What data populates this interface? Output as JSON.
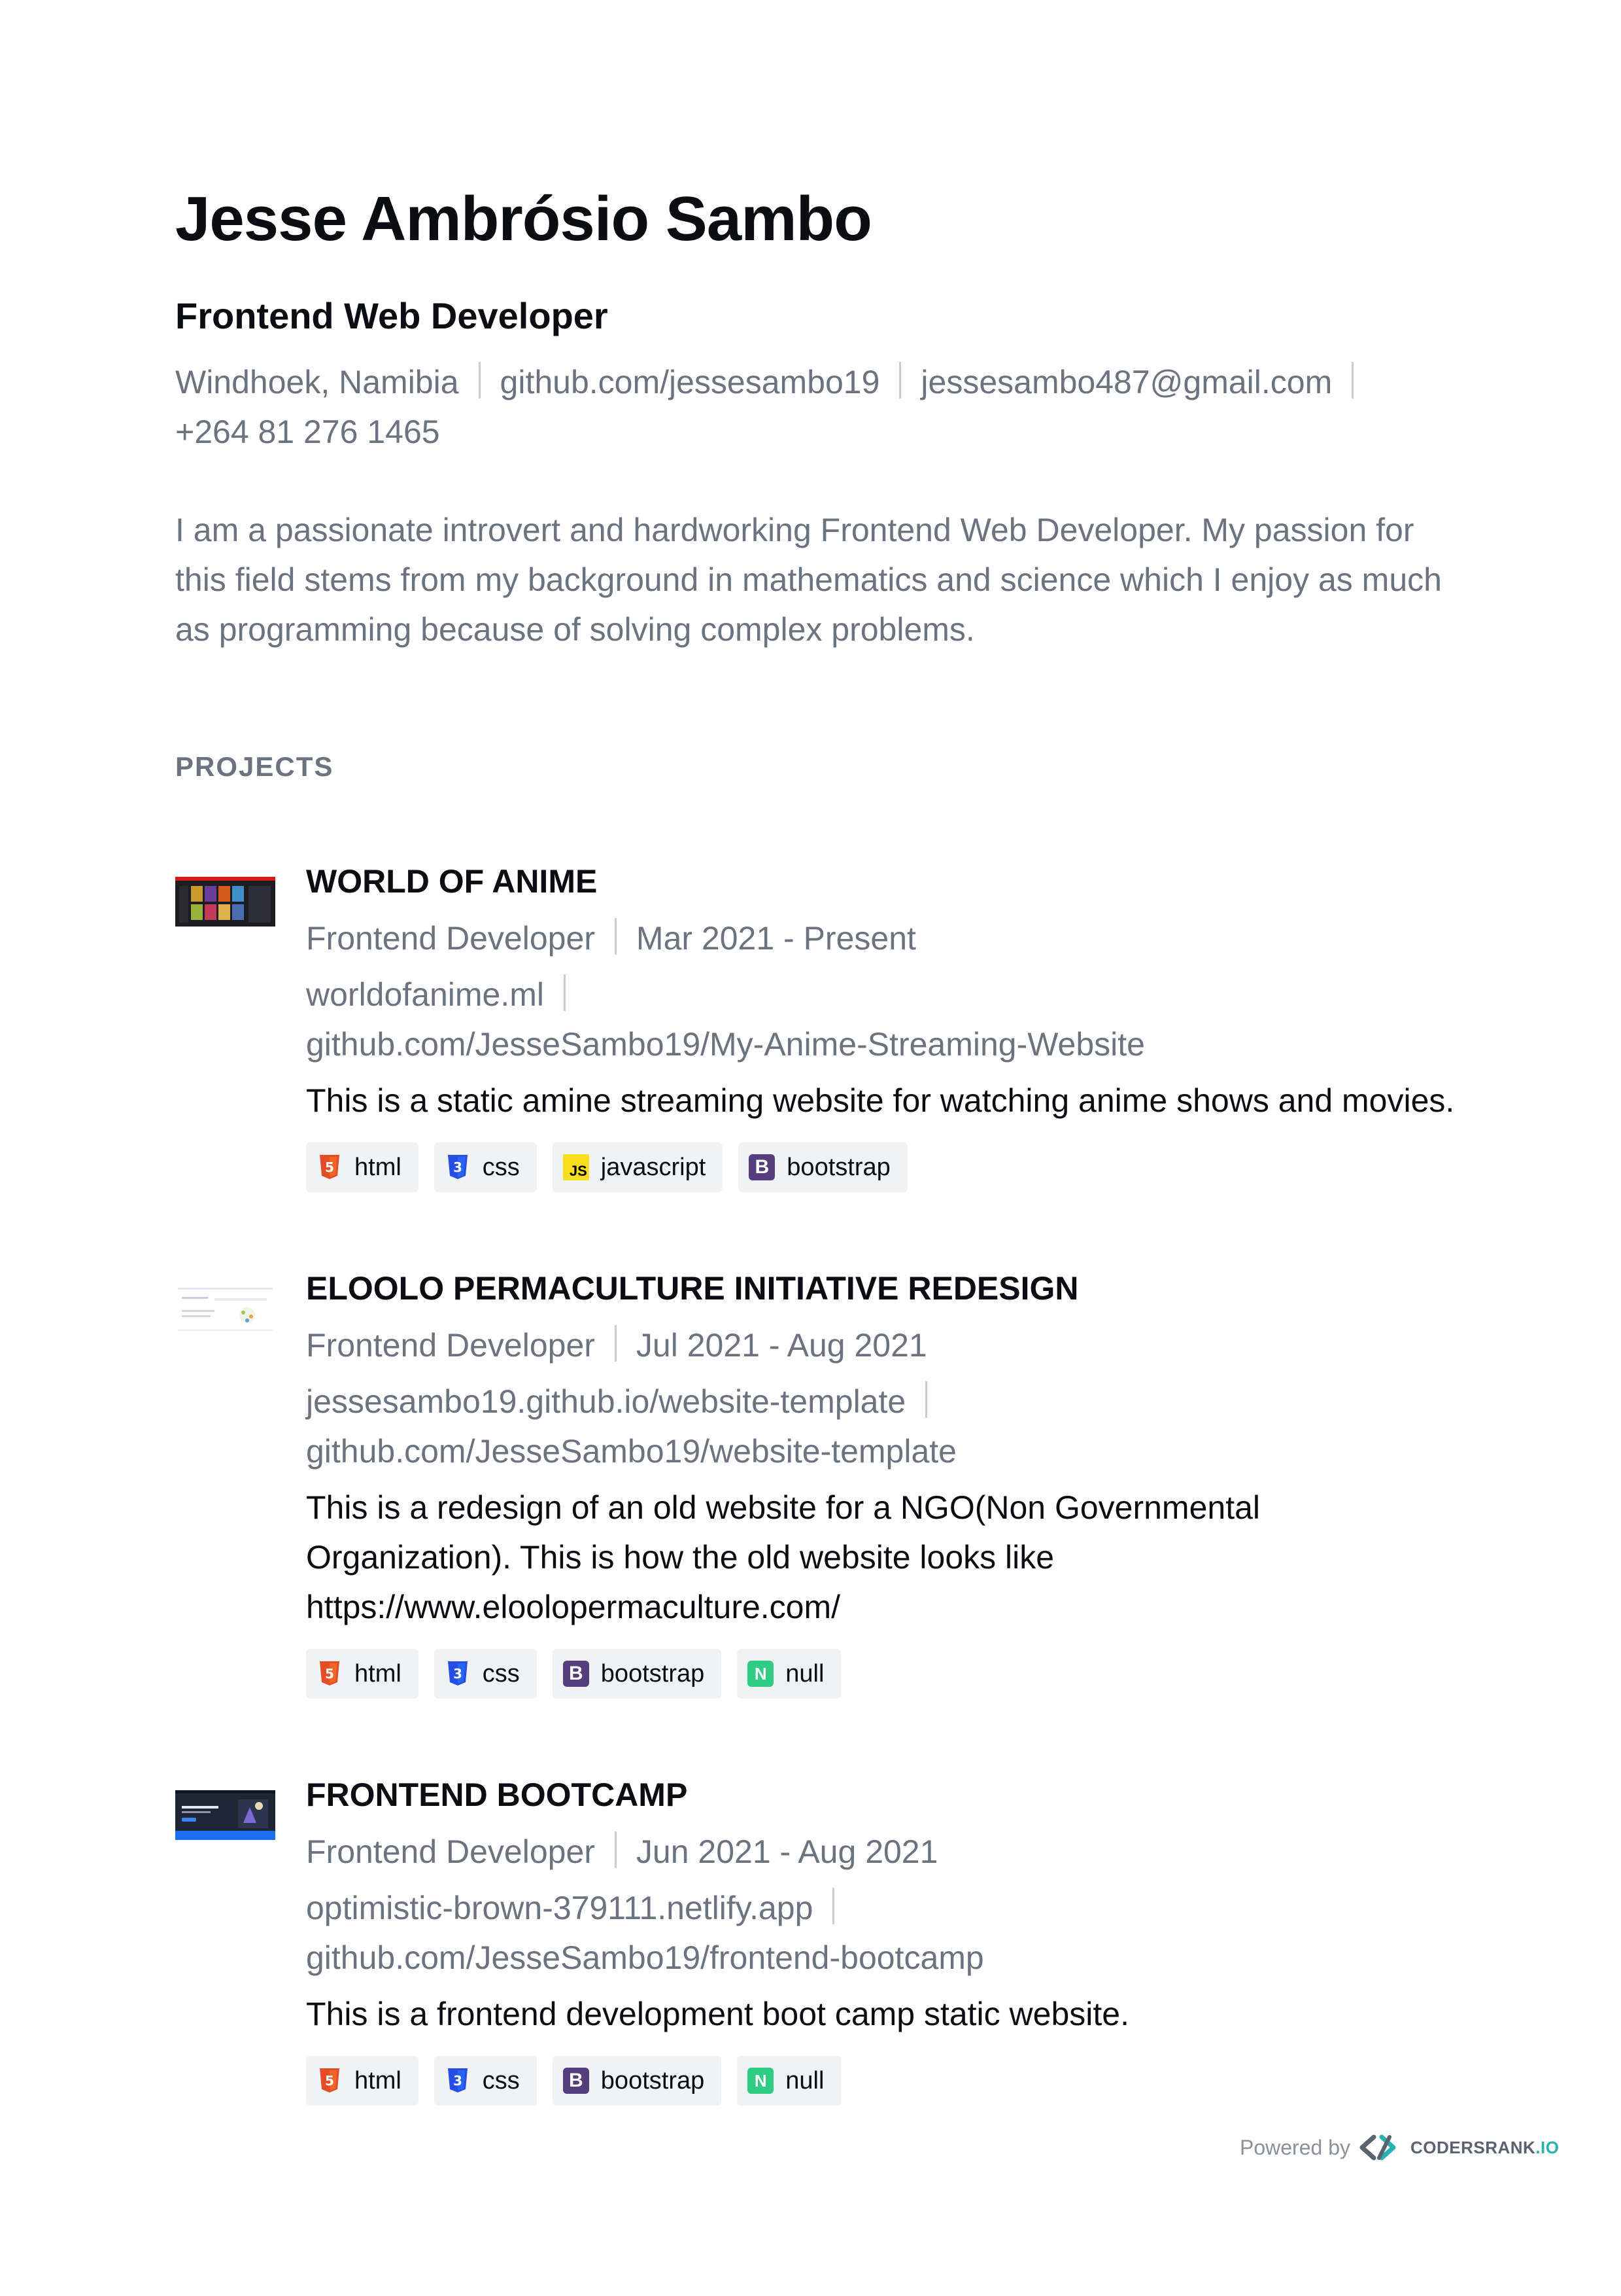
{
  "header": {
    "name": "Jesse Ambrósio Sambo",
    "role": "Frontend Web Developer",
    "location": "Windhoek, Namibia",
    "github": "github.com/jessesambo19",
    "email": "jessesambo487@gmail.com",
    "phone": "+264 81 276 1465"
  },
  "summary": "I am a passionate introvert and hardworking Frontend Web Developer. My passion for this field stems from my background in mathematics and science which I enjoy as much as programming because of solving complex problems.",
  "projects_title": "PROJECTS",
  "projects": [
    {
      "title": "WORLD OF ANIME",
      "role": "Frontend Developer",
      "dates": "Mar 2021 - Present",
      "link1": "worldofanime.ml",
      "link2": "github.com/JesseSambo19/My-Anime-Streaming-Website",
      "description": "This is a static amine streaming website for watching anime shows and movies.",
      "tags": [
        "html",
        "css",
        "javascript",
        "bootstrap"
      ]
    },
    {
      "title": "ELOOLO PERMACULTURE INITIATIVE REDESIGN",
      "role": "Frontend Developer",
      "dates": "Jul 2021 - Aug 2021",
      "link1": "jessesambo19.github.io/website-template",
      "link2": "github.com/JesseSambo19/website-template",
      "description": "This is a redesign of an old website for a NGO(Non Governmental Organization). This is how the old website looks like https://www.eloolopermaculture.com/",
      "tags": [
        "html",
        "css",
        "bootstrap",
        "null"
      ]
    },
    {
      "title": "FRONTEND BOOTCAMP",
      "role": "Frontend Developer",
      "dates": "Jun 2021 - Aug 2021",
      "link1": "optimistic-brown-379111.netlify.app",
      "link2": "github.com/JesseSambo19/frontend-bootcamp",
      "description": "This is a frontend development boot camp static website.",
      "tags": [
        "html",
        "css",
        "bootstrap",
        "null"
      ]
    }
  ],
  "footer": {
    "powered_by": "Powered by",
    "brand": "CODERSRANK",
    "brand_suffix": ".IO"
  },
  "icons": {
    "html": "html5-icon",
    "css": "css3-icon",
    "javascript": "javascript-icon",
    "bootstrap": "bootstrap-icon",
    "null": "n-icon"
  },
  "colors": {
    "html": "#e44d26",
    "css": "#264de4",
    "javascript": "#f7df1e",
    "bootstrap": "#563d7c",
    "null": "#2ecc85",
    "muted_text": "#6b7380"
  }
}
